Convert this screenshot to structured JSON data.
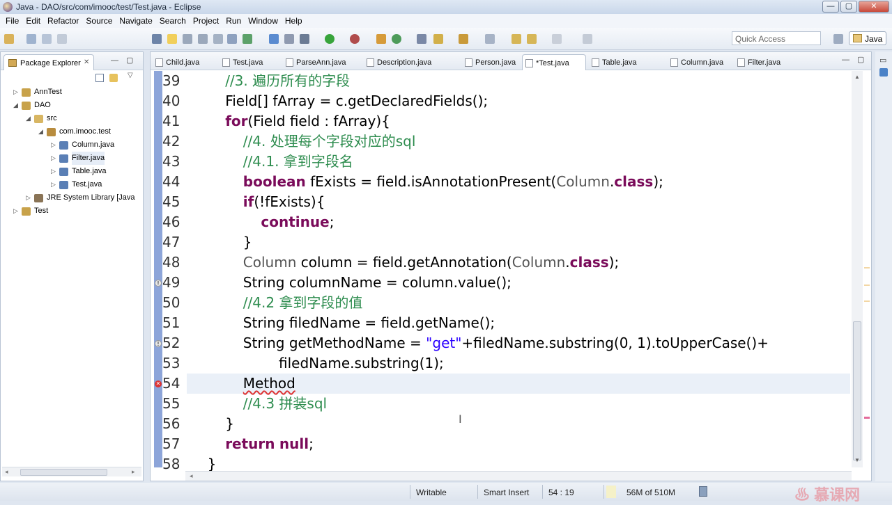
{
  "window": {
    "title": "Java - DAO/src/com/imooc/test/Test.java - Eclipse"
  },
  "menu": [
    "File",
    "Edit",
    "Refactor",
    "Source",
    "Navigate",
    "Search",
    "Project",
    "Run",
    "Window",
    "Help"
  ],
  "toolbar": {
    "quick_access_placeholder": "Quick Access",
    "perspective_label": "Java"
  },
  "package_explorer": {
    "title": "Package Explorer",
    "tree": [
      {
        "label": "AnnTest",
        "depth": 0,
        "kind": "project",
        "twisty": "▷"
      },
      {
        "label": "DAO",
        "depth": 0,
        "kind": "project",
        "twisty": "◢"
      },
      {
        "label": "src",
        "depth": 1,
        "kind": "folder",
        "twisty": "◢"
      },
      {
        "label": "com.imooc.test",
        "depth": 2,
        "kind": "package",
        "twisty": "◢"
      },
      {
        "label": "Column.java",
        "depth": 3,
        "kind": "file",
        "twisty": "▷"
      },
      {
        "label": "Filter.java",
        "depth": 3,
        "kind": "file",
        "twisty": "▷",
        "selected": true
      },
      {
        "label": "Table.java",
        "depth": 3,
        "kind": "file",
        "twisty": "▷"
      },
      {
        "label": "Test.java",
        "depth": 3,
        "kind": "file",
        "twisty": "▷"
      },
      {
        "label": "JRE System Library [Java",
        "depth": 1,
        "kind": "library",
        "twisty": "▷"
      },
      {
        "label": "Test",
        "depth": 0,
        "kind": "project",
        "twisty": "▷"
      }
    ]
  },
  "editor": {
    "tabs": [
      "Child.java",
      "Test.java",
      "ParseAnn.java",
      "Description.java",
      "Person.java",
      "*Test.java",
      "Table.java",
      "Column.java",
      "Filter.java"
    ],
    "active_tab": "*Test.java",
    "lines": [
      {
        "n": "39",
        "indent": 4,
        "parts": [
          [
            "cm",
            "//3. 遍历所有的字段"
          ]
        ]
      },
      {
        "n": "40",
        "indent": 4,
        "parts": [
          [
            "",
            "Field[] fArray = c.getDeclaredFields();"
          ]
        ]
      },
      {
        "n": "41",
        "indent": 4,
        "parts": [
          [
            "kw",
            "for"
          ],
          [
            "",
            "(Field field : fArray){"
          ]
        ]
      },
      {
        "n": "42",
        "indent": 6,
        "parts": [
          [
            "cm",
            "//4. 处理每个字段对应的sql"
          ]
        ]
      },
      {
        "n": "43",
        "indent": 6,
        "parts": [
          [
            "cm",
            "//4.1. 拿到字段名"
          ]
        ]
      },
      {
        "n": "44",
        "indent": 6,
        "parts": [
          [
            "kw",
            "boolean"
          ],
          [
            "",
            " fExists = field.isAnnotationPresent("
          ],
          [
            "gr",
            "Column"
          ],
          [
            "",
            "."
          ],
          [
            "kw",
            "class"
          ],
          [
            "",
            ");"
          ]
        ]
      },
      {
        "n": "45",
        "indent": 6,
        "parts": [
          [
            "kw",
            "if"
          ],
          [
            "",
            "(!fExists){"
          ]
        ]
      },
      {
        "n": "46",
        "indent": 8,
        "parts": [
          [
            "kw",
            "continue"
          ],
          [
            "",
            ";"
          ]
        ]
      },
      {
        "n": "47",
        "indent": 6,
        "parts": [
          [
            "",
            "}"
          ]
        ]
      },
      {
        "n": "48",
        "indent": 6,
        "parts": [
          [
            "gr",
            "Column"
          ],
          [
            "",
            " column = field.getAnnotation("
          ],
          [
            "gr",
            "Column"
          ],
          [
            "",
            "."
          ],
          [
            "kw",
            "class"
          ],
          [
            "",
            ");"
          ]
        ]
      },
      {
        "n": "49",
        "indent": 6,
        "marker": "warn",
        "parts": [
          [
            "",
            "String columnName = column.value();"
          ]
        ]
      },
      {
        "n": "50",
        "indent": 6,
        "parts": [
          [
            "cm",
            "//4.2 拿到字段的值"
          ]
        ]
      },
      {
        "n": "51",
        "indent": 6,
        "parts": [
          [
            "",
            "String filedName = field.getName();"
          ]
        ]
      },
      {
        "n": "52",
        "indent": 6,
        "marker": "warn",
        "parts": [
          [
            "",
            "String getMethodName = "
          ],
          [
            "st",
            "\"get\""
          ],
          [
            "",
            "+filedName.substring(0, 1).toUpperCase()+"
          ]
        ]
      },
      {
        "n": "53",
        "indent": 10,
        "parts": [
          [
            "",
            "filedName.substring(1);"
          ]
        ]
      },
      {
        "n": "54",
        "indent": 6,
        "marker": "error",
        "current": true,
        "parts": [
          [
            "",
            "Method"
          ]
        ]
      },
      {
        "n": "55",
        "indent": 6,
        "parts": [
          [
            "cm",
            "//4.3 拼装sql"
          ]
        ]
      },
      {
        "n": "56",
        "indent": 4,
        "parts": [
          [
            "",
            "}"
          ]
        ]
      },
      {
        "n": "57",
        "indent": 4,
        "parts": [
          [
            "kw",
            "return"
          ],
          [
            "",
            " "
          ],
          [
            "kw",
            "null"
          ],
          [
            "",
            ";"
          ]
        ]
      },
      {
        "n": "58",
        "indent": 2,
        "parts": [
          [
            "",
            "}"
          ]
        ]
      }
    ]
  },
  "status": {
    "writable": "Writable",
    "insert_mode": "Smart Insert",
    "position": "54 : 19",
    "heap": "56M of 510M"
  }
}
